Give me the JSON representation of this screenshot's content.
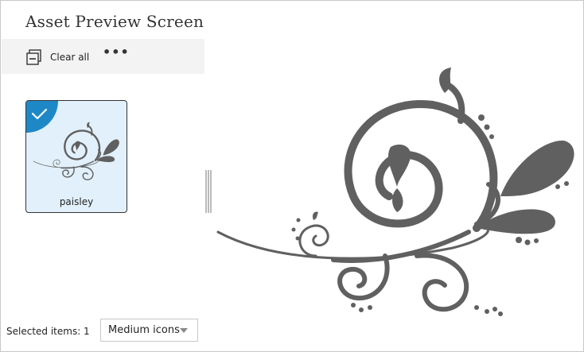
{
  "window": {
    "title": "Asset Preview Screen"
  },
  "toolbar": {
    "clear_all_label": "Clear all",
    "more_label": "•••"
  },
  "assets": [
    {
      "name": "paisley",
      "selected": true
    }
  ],
  "status": {
    "selected_items_text": "Selected items: 1"
  },
  "view_mode": {
    "selected": "Medium icons"
  },
  "colors": {
    "accent": "#1e88c7",
    "tile_bg": "#e2f0fb",
    "paisley": "#606060",
    "toolbar_bg": "#f3f3f3"
  },
  "icons": {
    "clear_all": "clear-all-icon",
    "more": "more-icon",
    "check": "checkmark-icon",
    "dropdown": "chevron-down-icon"
  }
}
